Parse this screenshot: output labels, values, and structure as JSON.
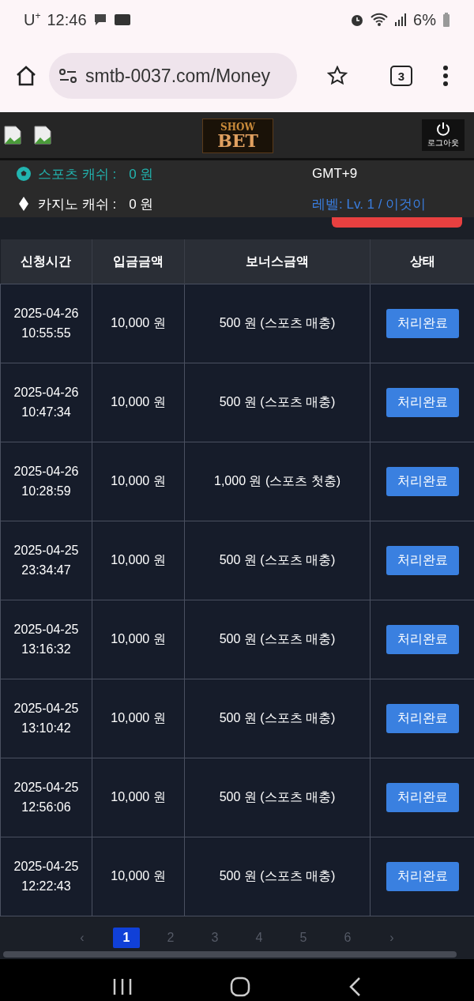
{
  "status_bar": {
    "carrier": "U$^{+}$",
    "time": "12:46",
    "battery": "6%"
  },
  "browser": {
    "url": "smtb-0037.com/Money",
    "tab_count": "3"
  },
  "header": {
    "logo_top": "SHOW",
    "logo_bottom": "BET",
    "logout": "로그아웃"
  },
  "info": {
    "sports_label": "스포츠 캐쉬 :",
    "sports_value": "0 원",
    "casino_label": "카지노 캐쉬 :",
    "casino_value": "0 원",
    "timezone": "GMT+9",
    "level": "레벨: Lv. 1 / 이것이"
  },
  "table": {
    "columns": [
      "신청시간",
      "입금금액",
      "보너스금액",
      "상태"
    ],
    "rows": [
      {
        "date": "2025-04-26",
        "time": "10:55:55",
        "deposit": "10,000 원",
        "bonus": "500 원 (스포츠 매충)",
        "status": "처리완료"
      },
      {
        "date": "2025-04-26",
        "time": "10:47:34",
        "deposit": "10,000 원",
        "bonus": "500 원 (스포츠 매충)",
        "status": "처리완료"
      },
      {
        "date": "2025-04-26",
        "time": "10:28:59",
        "deposit": "10,000 원",
        "bonus": "1,000 원 (스포츠 첫충)",
        "status": "처리완료"
      },
      {
        "date": "2025-04-25",
        "time": "23:34:47",
        "deposit": "10,000 원",
        "bonus": "500 원 (스포츠 매충)",
        "status": "처리완료"
      },
      {
        "date": "2025-04-25",
        "time": "13:16:32",
        "deposit": "10,000 원",
        "bonus": "500 원 (스포츠 매충)",
        "status": "처리완료"
      },
      {
        "date": "2025-04-25",
        "time": "13:10:42",
        "deposit": "10,000 원",
        "bonus": "500 원 (스포츠 매충)",
        "status": "처리완료"
      },
      {
        "date": "2025-04-25",
        "time": "12:56:06",
        "deposit": "10,000 원",
        "bonus": "500 원 (스포츠 매충)",
        "status": "처리완료"
      },
      {
        "date": "2025-04-25",
        "time": "12:22:43",
        "deposit": "10,000 원",
        "bonus": "500 원 (스포츠 매충)",
        "status": "처리완료"
      }
    ]
  },
  "pagination": {
    "prev": "‹",
    "next": "›",
    "pages": [
      {
        "label": "1",
        "selected": true
      },
      {
        "label": "2",
        "selected": false
      },
      {
        "label": "3",
        "selected": false
      },
      {
        "label": "4",
        "selected": false
      },
      {
        "label": "5",
        "selected": false
      },
      {
        "label": "6",
        "selected": false
      }
    ]
  }
}
